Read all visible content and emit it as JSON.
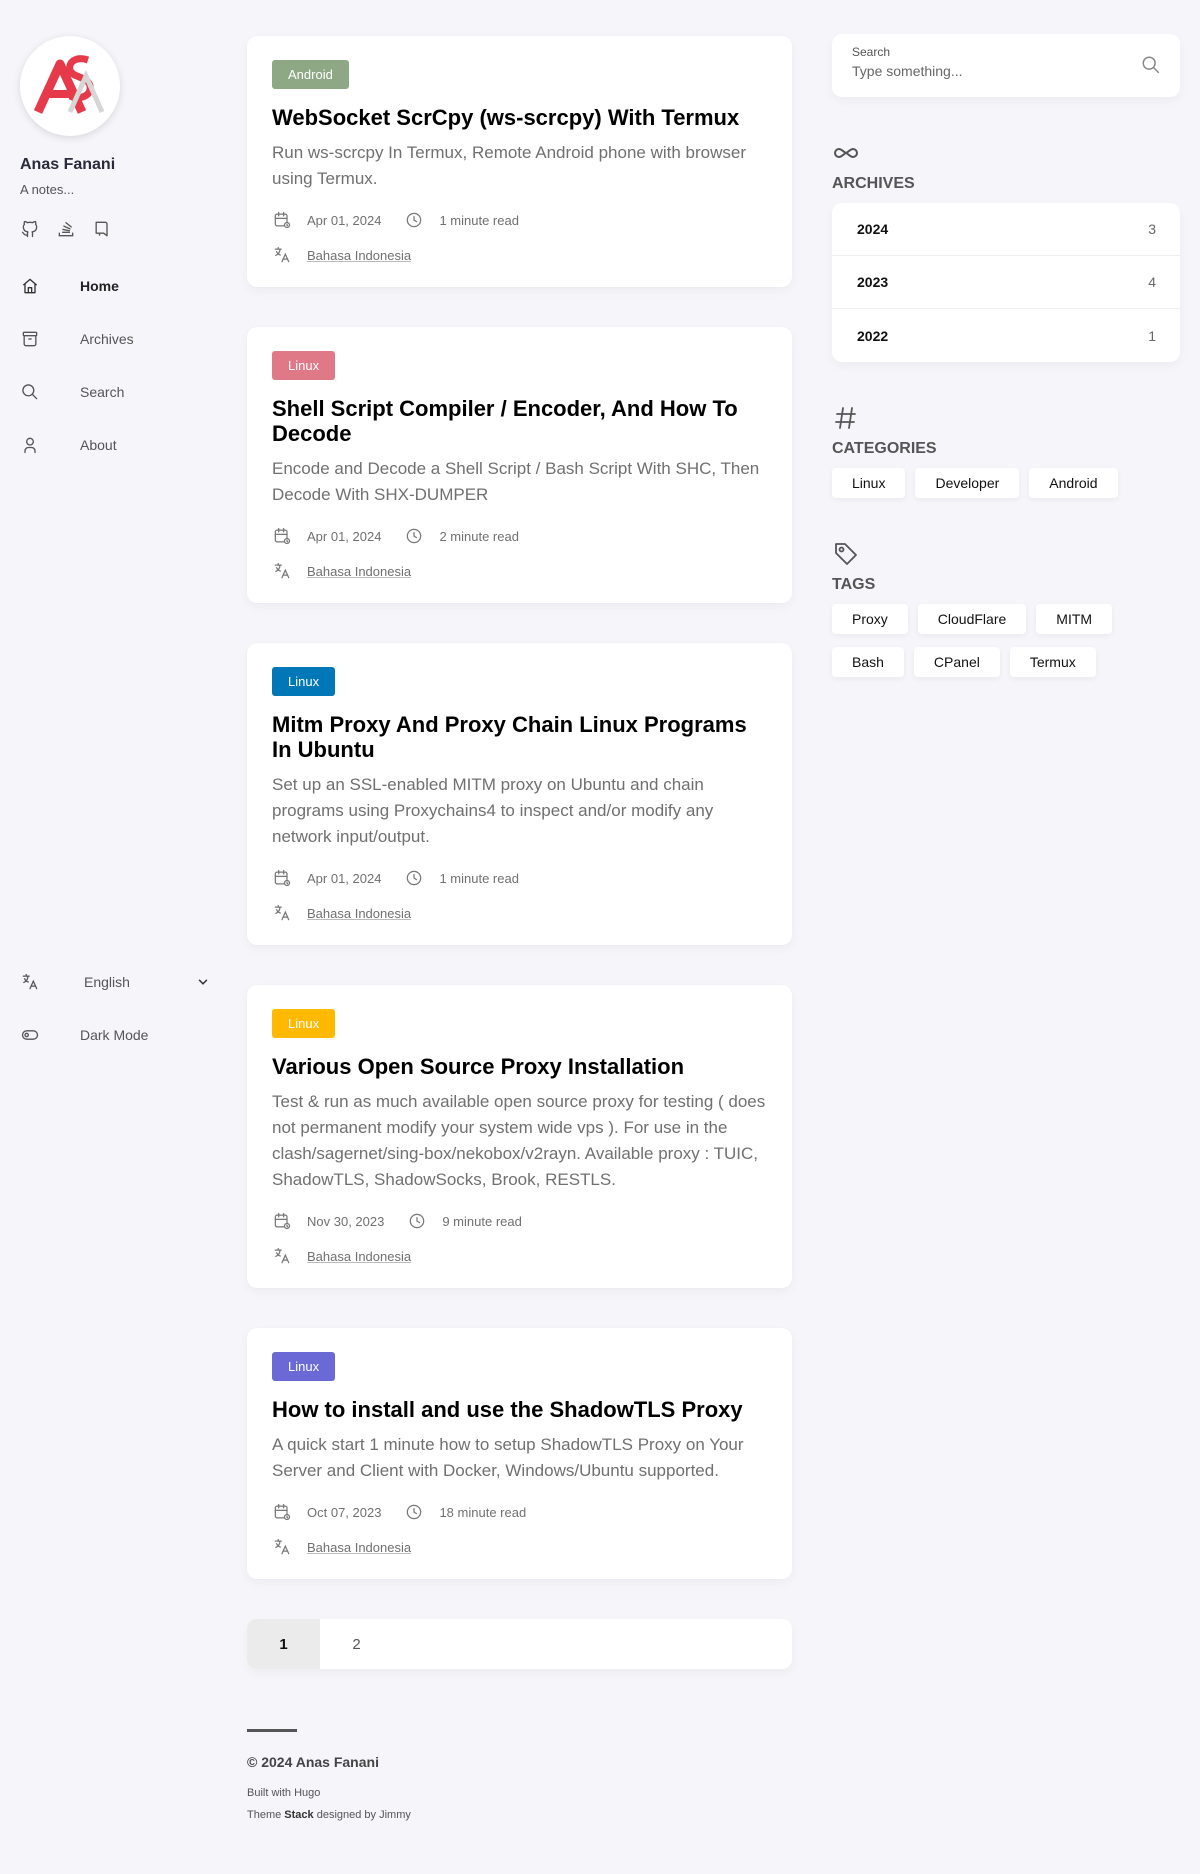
{
  "profile": {
    "name": "Anas Fanani",
    "description": "A notes..."
  },
  "social_icons": [
    "github-icon",
    "stack-overflow-icon",
    "book-icon"
  ],
  "menu": [
    {
      "label": "Home",
      "icon": "home-icon",
      "active": true
    },
    {
      "label": "Archives",
      "icon": "archive-icon"
    },
    {
      "label": "Search",
      "icon": "search-icon"
    },
    {
      "label": "About",
      "icon": "user-icon"
    }
  ],
  "language": {
    "selected": "English"
  },
  "dark_mode": {
    "label": "Dark Mode"
  },
  "articles": [
    {
      "category": "Android",
      "category_color": "#8ea885",
      "title": "WebSocket ScrCpy (ws-scrcpy) With Termux",
      "excerpt": "Run ws-scrcpy In Termux, Remote Android phone with browser using Termux.",
      "date": "Apr 01, 2024",
      "read_time": "1 minute read",
      "translation": "Bahasa Indonesia"
    },
    {
      "category": "Linux",
      "category_color": "#df7988",
      "title": "Shell Script Compiler / Encoder, And How To Decode",
      "excerpt": "Encode and Decode a Shell Script / Bash Script With SHC, Then Decode With SHX-DUMPER",
      "date": "Apr 01, 2024",
      "read_time": "2 minute read",
      "translation": "Bahasa Indonesia"
    },
    {
      "category": "Linux",
      "category_color": "#0177b8",
      "title": "Mitm Proxy And Proxy Chain Linux Programs In Ubuntu",
      "excerpt": "Set up an SSL-enabled MITM proxy on Ubuntu and chain programs using Proxychains4 to inspect and/or modify any network input/output.",
      "date": "Apr 01, 2024",
      "read_time": "1 minute read",
      "translation": "Bahasa Indonesia"
    },
    {
      "category": "Linux",
      "category_color": "#ffb900",
      "title": "Various Open Source Proxy Installation",
      "excerpt": "Test & run as much available open source proxy for testing ( does not permanent modify your system wide vps ). For use in the clash/sagernet/sing-box/nekobox/v2rayn. Available proxy : TUIC, ShadowTLS, ShadowSocks, Brook, RESTLS.",
      "date": "Nov 30, 2023",
      "read_time": "9 minute read",
      "translation": "Bahasa Indonesia"
    },
    {
      "category": "Linux",
      "category_color": "#6b69d6",
      "title": "How to install and use the ShadowTLS Proxy",
      "excerpt": "A quick start 1 minute how to setup ShadowTLS Proxy on Your Server and Client with Docker, Windows/Ubuntu supported.",
      "date": "Oct 07, 2023",
      "read_time": "18 minute read",
      "translation": "Bahasa Indonesia"
    }
  ],
  "pagination": {
    "pages": [
      "1",
      "2"
    ],
    "current": "1"
  },
  "footer": {
    "copyright": "© 2024 Anas Fanani",
    "built_prefix": "Built with ",
    "built_with": "Hugo",
    "theme_prefix": "Theme ",
    "theme_name": "Stack",
    "theme_suffix": " designed by ",
    "theme_author": "Jimmy"
  },
  "search": {
    "label": "Search",
    "placeholder": "Type something..."
  },
  "archives": {
    "title": "ARCHIVES",
    "years": [
      {
        "year": "2024",
        "count": "3"
      },
      {
        "year": "2023",
        "count": "4"
      },
      {
        "year": "2022",
        "count": "1"
      }
    ]
  },
  "categories": {
    "title": "CATEGORIES",
    "items": [
      "Linux",
      "Developer",
      "Android"
    ]
  },
  "tags": {
    "title": "TAGS",
    "items": [
      "Proxy",
      "CloudFlare",
      "MITM",
      "Bash",
      "CPanel",
      "Termux"
    ]
  }
}
